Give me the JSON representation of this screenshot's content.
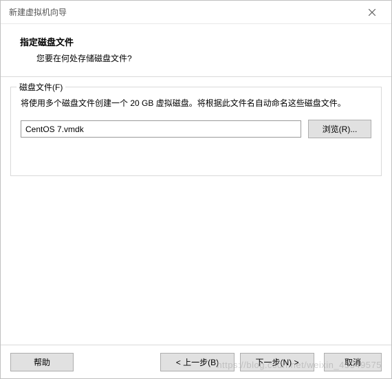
{
  "window": {
    "title": "新建虚拟机向导"
  },
  "header": {
    "title": "指定磁盘文件",
    "subtitle": "您要在何处存储磁盘文件?"
  },
  "group": {
    "legend": "磁盘文件(F)",
    "description": "将使用多个磁盘文件创建一个 20 GB 虚拟磁盘。将根据此文件名自动命名这些磁盘文件。",
    "file_value": "CentOS 7.vmdk",
    "browse_label": "浏览(R)..."
  },
  "buttons": {
    "help": "帮助",
    "back": "< 上一步(B)",
    "next": "下一步(N) >",
    "cancel": "取消"
  },
  "watermark": "https://blog.csdn.net/weixin_45349575"
}
